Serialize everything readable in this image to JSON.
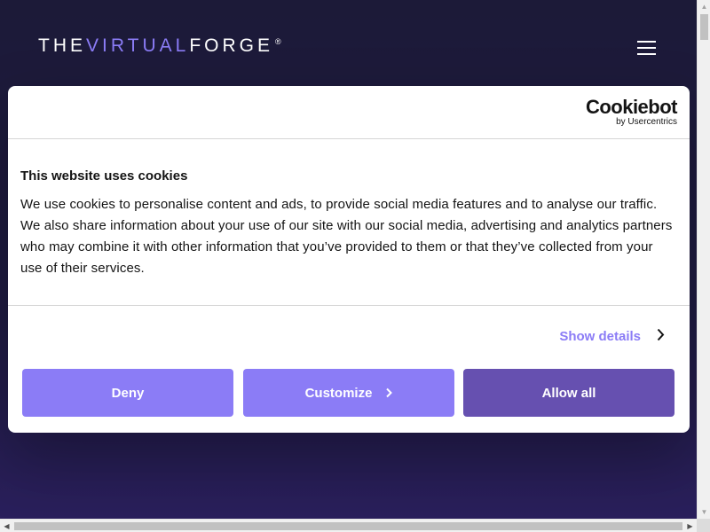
{
  "site": {
    "logo_part1": "THE",
    "logo_part2": "VIRTUAL",
    "logo_part3": "FORGE",
    "logo_mark": "®",
    "menu_icon": "hamburger-menu-icon"
  },
  "cookie_dialog": {
    "brand": "Cookiebot",
    "brand_sub": "by Usercentrics",
    "title": "This website uses cookies",
    "text": "We use cookies to personalise content and ads, to provide social media features and to analyse our traffic. We also share information about your use of our site with our social media, advertising and analytics partners who may combine it with other information that you’ve provided to them or that they’ve collected from your use of their services.",
    "show_details_label": "Show details",
    "deny_label": "Deny",
    "customize_label": "Customize",
    "allow_all_label": "Allow all"
  },
  "colors": {
    "accent": "#8b7cf6",
    "allow_all": "#6650b0",
    "background": "#1c1a38"
  }
}
